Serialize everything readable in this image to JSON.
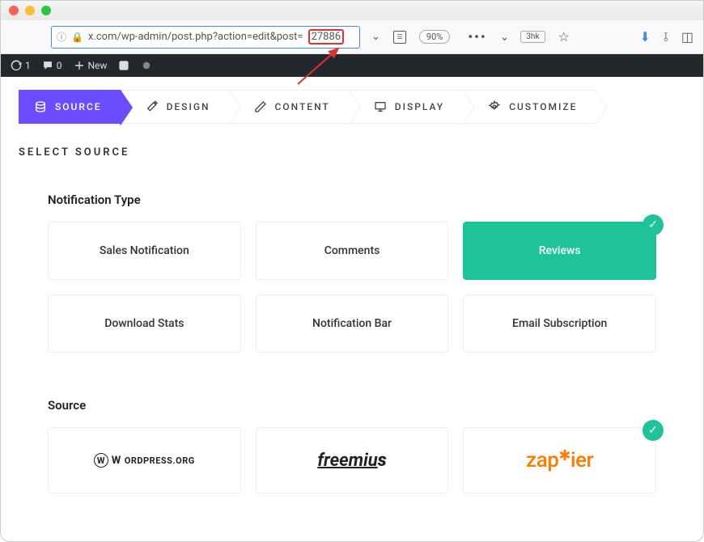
{
  "titlebar": {},
  "urlbar": {
    "url_text": "x.com/wp-admin/post.php?action=edit&post=",
    "post_id": "27886",
    "zoom": "90%",
    "pill_label": "3hk"
  },
  "adminbar": {
    "refresh_count": "1",
    "comments_count": "0",
    "new_label": "New"
  },
  "steps": [
    {
      "label": "SOURCE"
    },
    {
      "label": "DESIGN"
    },
    {
      "label": "CONTENT"
    },
    {
      "label": "DISPLAY"
    },
    {
      "label": "CUSTOMIZE"
    }
  ],
  "section_title": "SELECT SOURCE",
  "notification_type": {
    "title": "Notification Type",
    "items": [
      {
        "label": "Sales Notification"
      },
      {
        "label": "Comments"
      },
      {
        "label": "Reviews"
      },
      {
        "label": "Download Stats"
      },
      {
        "label": "Notification Bar"
      },
      {
        "label": "Email Subscription"
      }
    ]
  },
  "source": {
    "title": "Source",
    "wp": "ORDPRESS.ORG",
    "freemius": "freemiu",
    "freemius_s": "s",
    "zapier_a": "zap",
    "zapier_b": "ier"
  }
}
